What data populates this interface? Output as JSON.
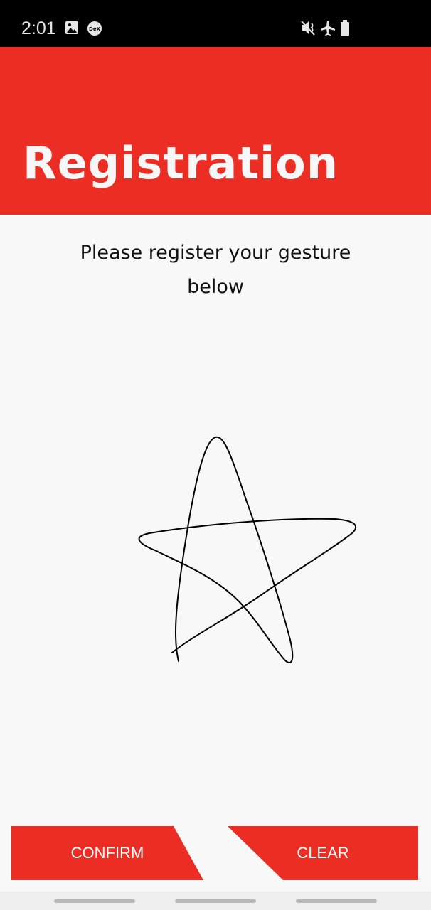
{
  "status_bar": {
    "time": "2:01",
    "left_icons": [
      "image-icon",
      "dex-icon"
    ],
    "dex_label": "DeX",
    "right_icons": [
      "vibrate-mute-icon",
      "airplane-mode-icon",
      "battery-icon"
    ]
  },
  "header": {
    "title": "Registration",
    "color": "#ec2d24"
  },
  "instruction": "Please register your gesture below",
  "gesture": {
    "shape": "star",
    "stroke_color": "#000000"
  },
  "buttons": {
    "confirm": "CONFIRM",
    "clear": "CLEAR"
  },
  "nav_bar": {
    "items": [
      "recent-apps",
      "home",
      "back"
    ]
  }
}
